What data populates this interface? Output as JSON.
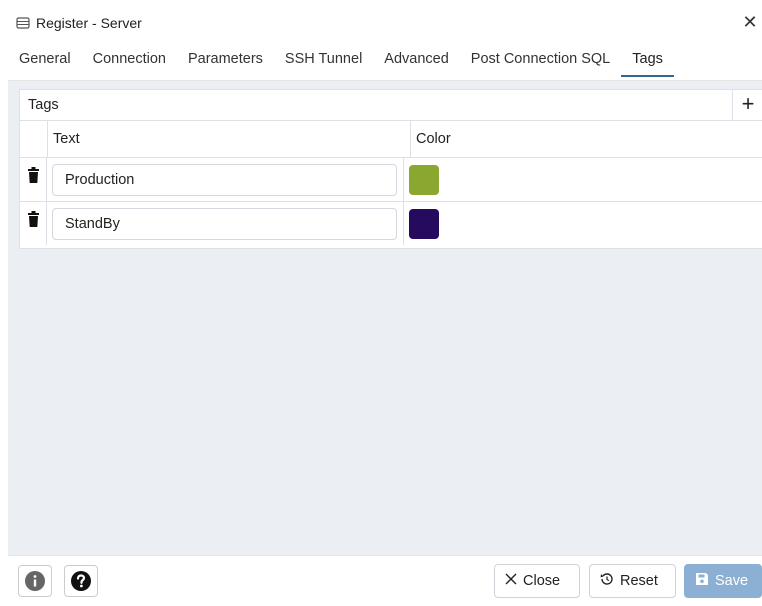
{
  "window": {
    "title": "Register - Server",
    "close_symbol": "✕"
  },
  "tabs": [
    {
      "label": "General"
    },
    {
      "label": "Connection"
    },
    {
      "label": "Parameters"
    },
    {
      "label": "SSH Tunnel"
    },
    {
      "label": "Advanced"
    },
    {
      "label": "Post Connection SQL"
    },
    {
      "label": "Tags",
      "active": true
    }
  ],
  "tags_panel": {
    "title": "Tags",
    "add_symbol": "+",
    "columns": {
      "text": "Text",
      "color": "Color"
    },
    "rows": [
      {
        "text": "Production",
        "color": "#8aa72f"
      },
      {
        "text": "StandBy",
        "color": "#260a5e"
      }
    ]
  },
  "footer": {
    "close_label": "Close",
    "reset_label": "Reset",
    "save_label": "Save"
  },
  "icons": [
    "server-icon",
    "close-icon",
    "add-icon",
    "trash-icon",
    "info-icon",
    "help-icon",
    "x-icon",
    "reset-icon",
    "save-icon"
  ]
}
